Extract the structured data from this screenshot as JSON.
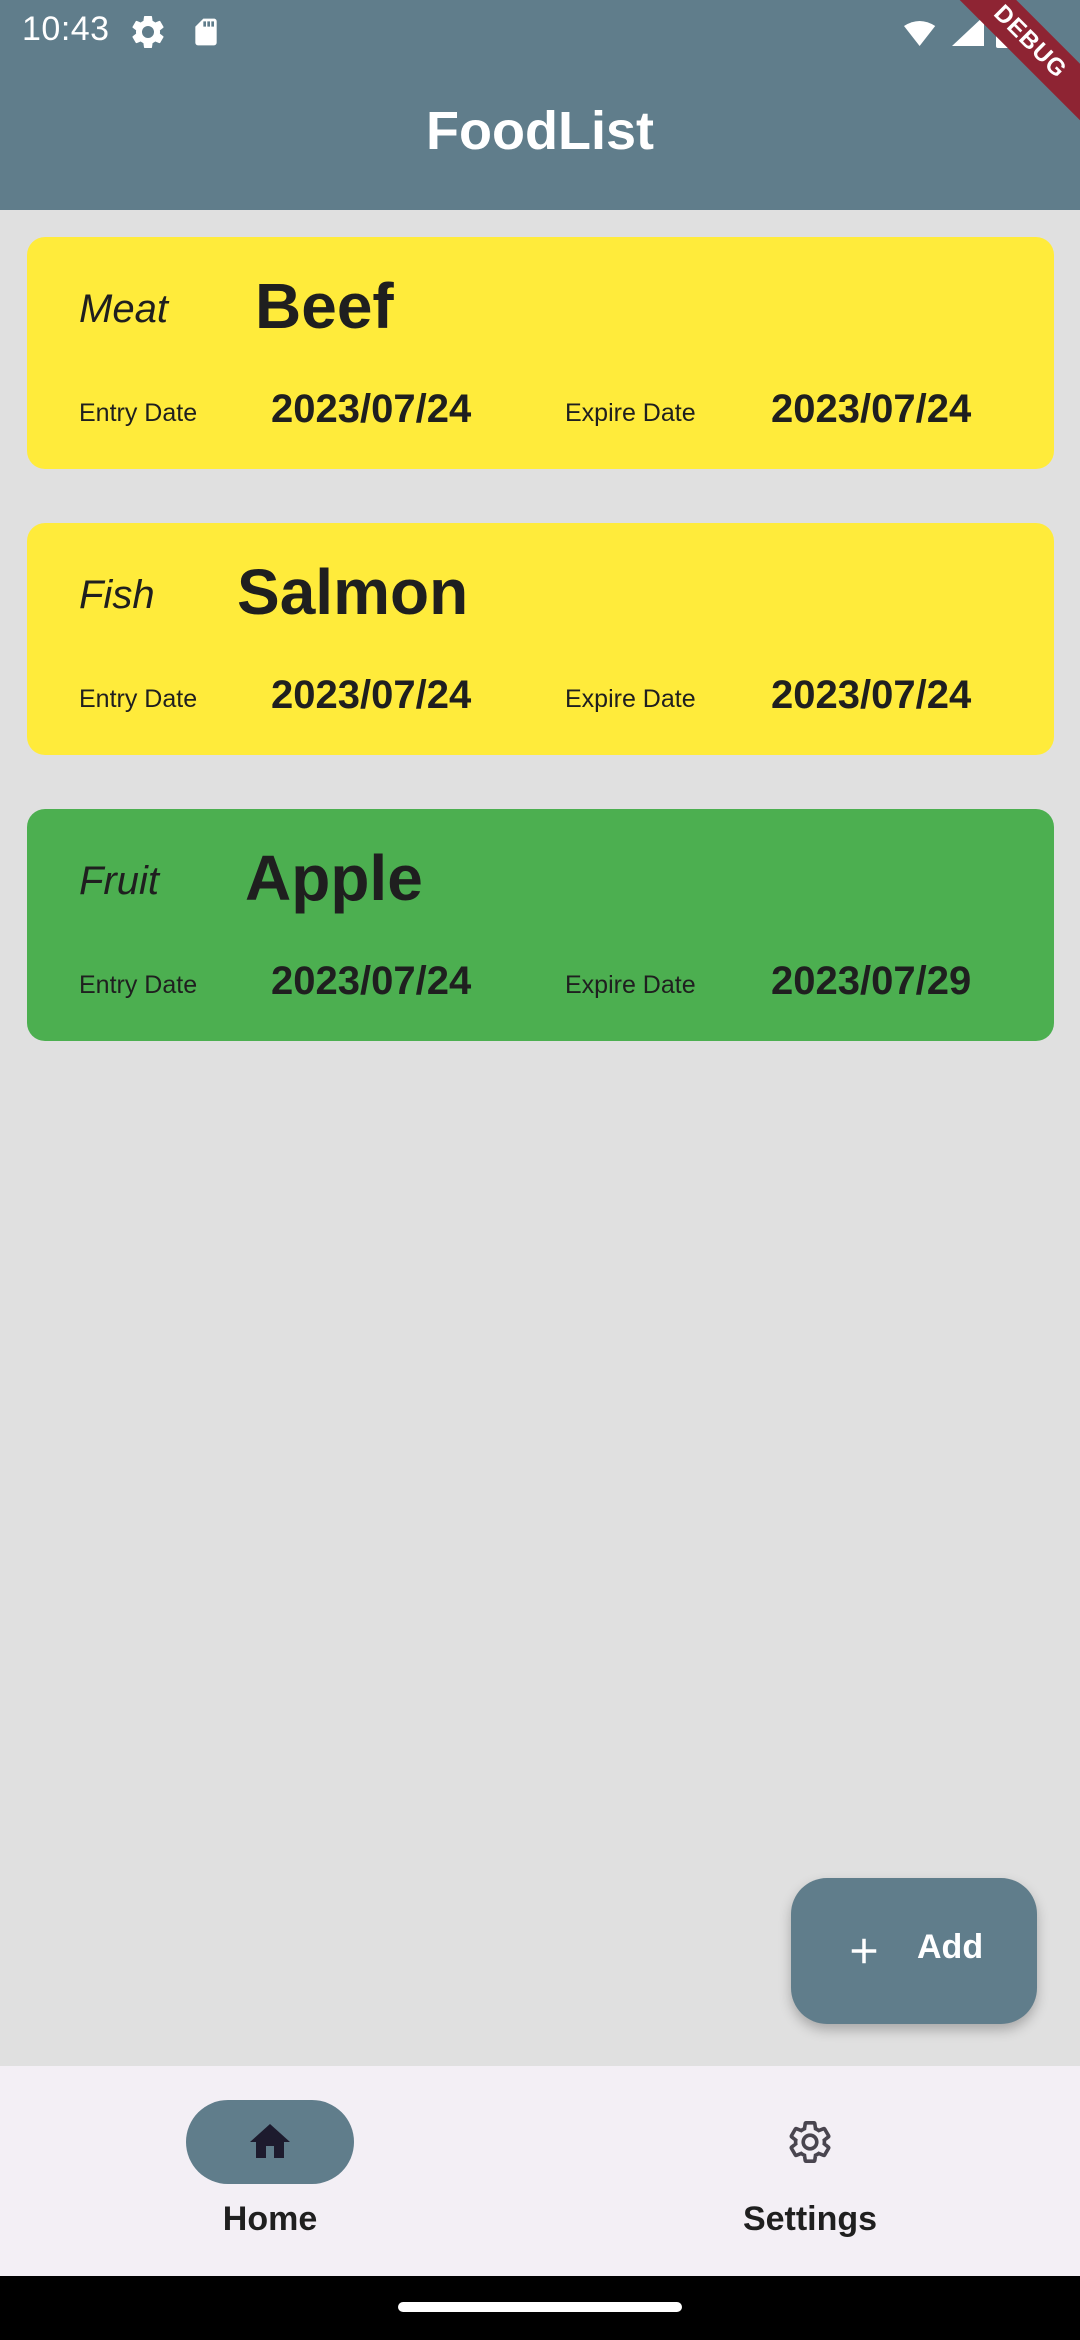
{
  "status_bar": {
    "time": "10:43",
    "left_icons": [
      "gear-icon",
      "sd-card-icon"
    ],
    "right_icons": [
      "wifi-icon",
      "signal-icon",
      "battery-icon"
    ]
  },
  "app_bar": {
    "title": "FoodList",
    "debug_banner": "DEBUG",
    "color": "#607d8b"
  },
  "food_items": [
    {
      "category": "Meat",
      "name": "Beef",
      "entry_label": "Entry Date",
      "entry_date": "2023/07/24",
      "expire_label": "Expire Date",
      "expire_date": "2023/07/24",
      "color": "#ffeb3b"
    },
    {
      "category": "Fish",
      "name": "Salmon",
      "entry_label": "Entry Date",
      "entry_date": "2023/07/24",
      "expire_label": "Expire Date",
      "expire_date": "2023/07/24",
      "color": "#ffeb3b"
    },
    {
      "category": "Fruit",
      "name": "Apple",
      "entry_label": "Entry Date",
      "entry_date": "2023/07/24",
      "expire_label": "Expire Date",
      "expire_date": "2023/07/29",
      "color": "#4caf50"
    }
  ],
  "fab": {
    "icon": "plus-icon",
    "label": "Add"
  },
  "bottom_nav": {
    "items": [
      {
        "label": "Home",
        "icon": "home-icon",
        "selected": true
      },
      {
        "label": "Settings",
        "icon": "gear-icon",
        "selected": false
      }
    ]
  },
  "colors": {
    "background": "#e0e0e0",
    "nav_background": "#f3eff5",
    "accent": "#607d8b"
  }
}
